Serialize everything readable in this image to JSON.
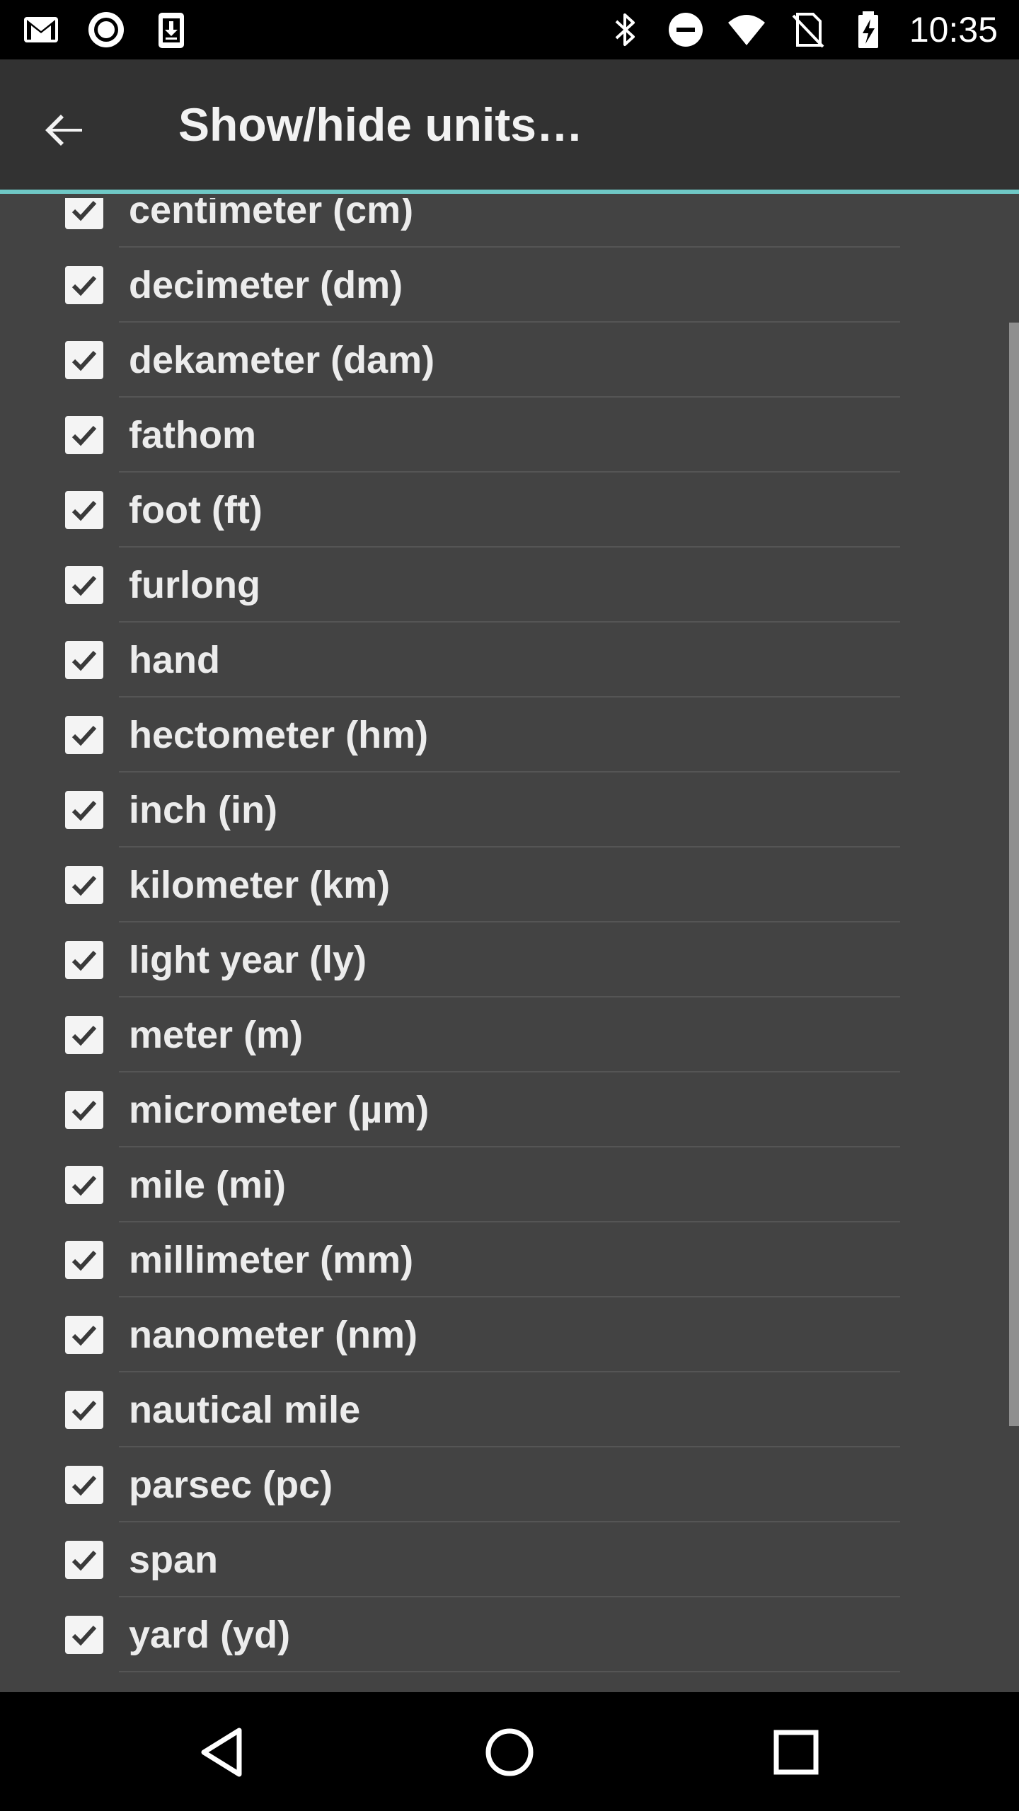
{
  "status_bar": {
    "left_icons": [
      "gmail-icon",
      "record-icon",
      "download-icon"
    ],
    "right_icons": [
      "bluetooth-icon",
      "do-not-disturb-icon",
      "wifi-icon",
      "no-sim-icon",
      "battery-charging-icon"
    ],
    "time": "10:35"
  },
  "app_bar": {
    "title": "Show/hide units…",
    "accent_color": "#6fc8c6"
  },
  "units": [
    {
      "label": "centimeter (cm)",
      "checked": true
    },
    {
      "label": "decimeter (dm)",
      "checked": true
    },
    {
      "label": "dekameter (dam)",
      "checked": true
    },
    {
      "label": "fathom",
      "checked": true
    },
    {
      "label": "foot (ft)",
      "checked": true
    },
    {
      "label": "furlong",
      "checked": true
    },
    {
      "label": "hand",
      "checked": true
    },
    {
      "label": "hectometer (hm)",
      "checked": true
    },
    {
      "label": "inch (in)",
      "checked": true
    },
    {
      "label": "kilometer (km)",
      "checked": true
    },
    {
      "label": "light year (ly)",
      "checked": true
    },
    {
      "label": "meter (m)",
      "checked": true
    },
    {
      "label": "micrometer (µm)",
      "checked": true
    },
    {
      "label": "mile (mi)",
      "checked": true
    },
    {
      "label": "millimeter (mm)",
      "checked": true
    },
    {
      "label": "nanometer (nm)",
      "checked": true
    },
    {
      "label": "nautical mile",
      "checked": true
    },
    {
      "label": "parsec (pc)",
      "checked": true
    },
    {
      "label": "span",
      "checked": true
    },
    {
      "label": "yard (yd)",
      "checked": true
    }
  ],
  "nav_bar": {
    "buttons": [
      "back-nav-icon",
      "home-nav-icon",
      "recents-nav-icon"
    ]
  }
}
